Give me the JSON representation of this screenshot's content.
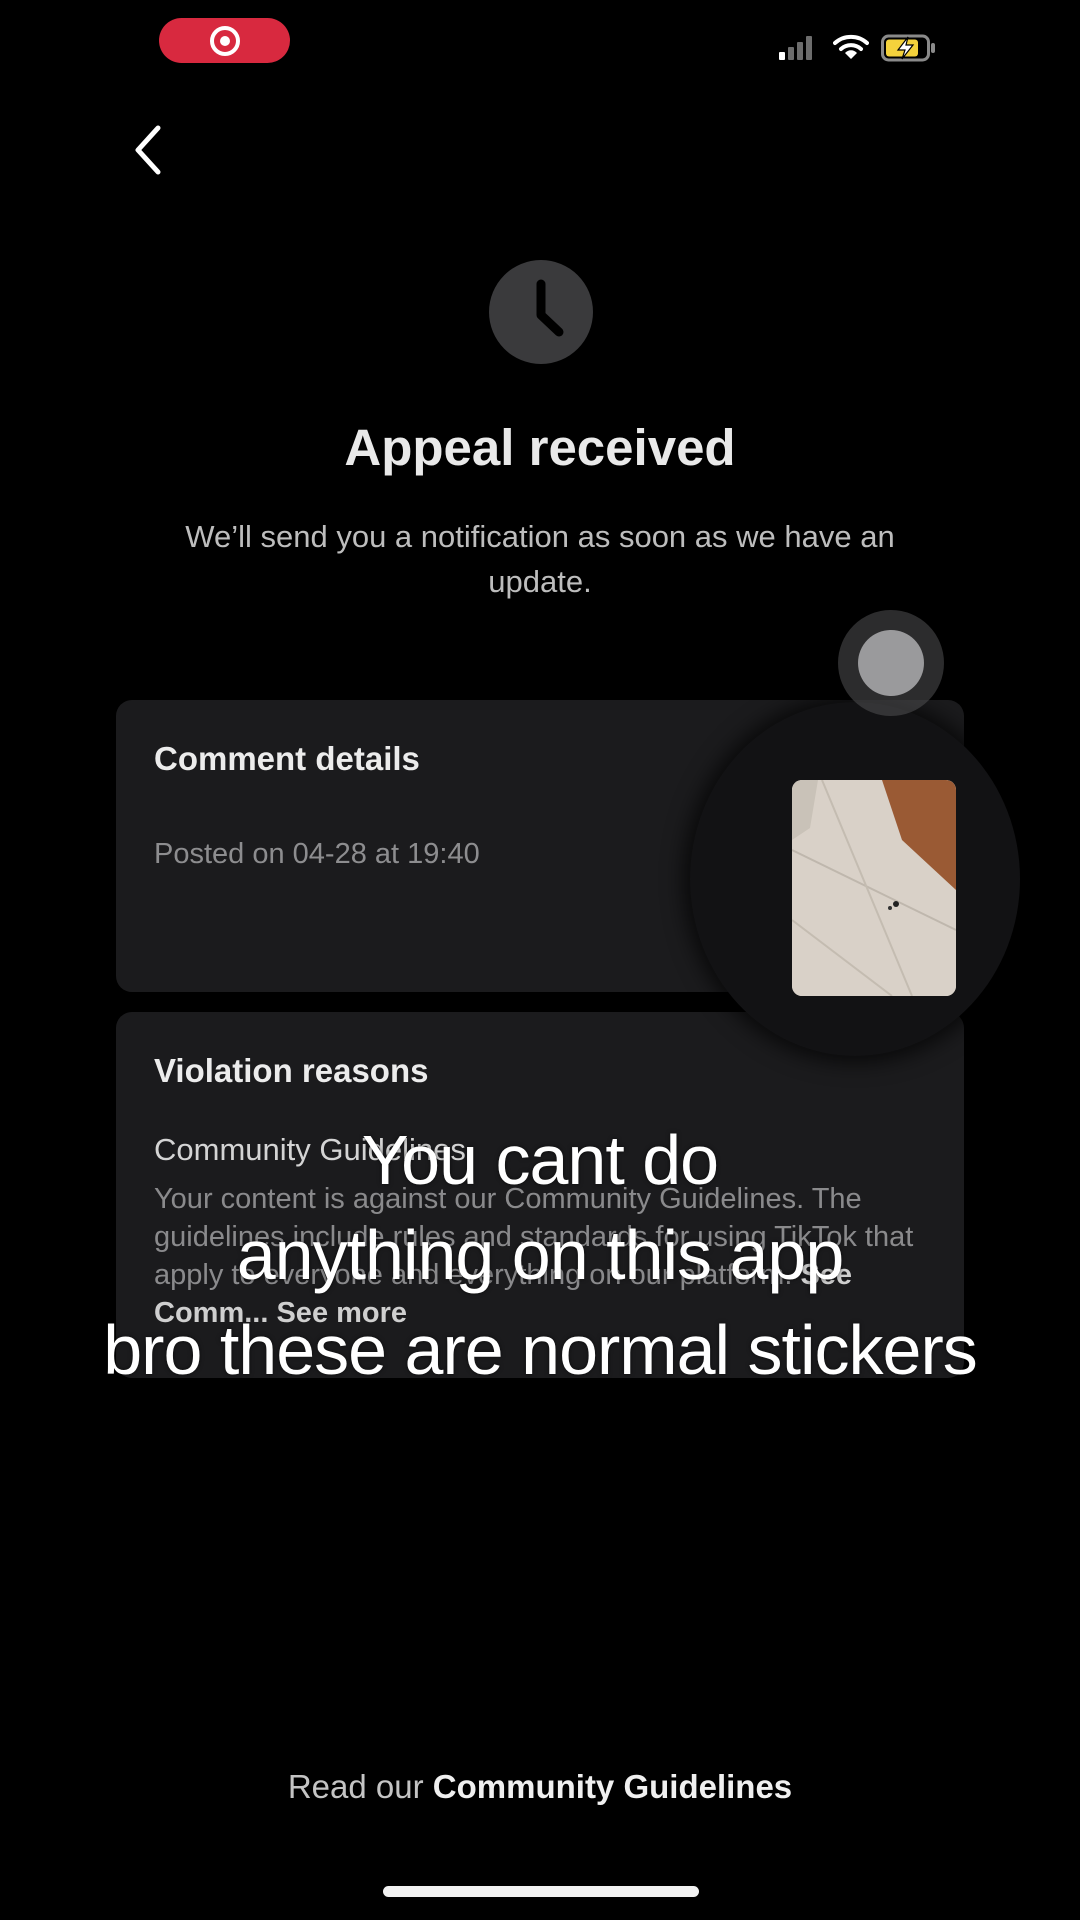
{
  "status_bar": {
    "recording_icon": "screen-recording-icon",
    "signal_icon": "cellular-signal-icon",
    "wifi_icon": "wifi-icon",
    "battery_icon": "battery-charging-icon",
    "battery_color": "#f4d23c"
  },
  "nav": {
    "back_icon": "chevron-left-icon"
  },
  "header": {
    "status_icon": "clock-icon",
    "title": "Appeal received",
    "subtitle": "We’ll send you a notification as soon as we have an update."
  },
  "comment_card": {
    "title": "Comment details",
    "posted": "Posted on 04-28 at 19:40",
    "thumbnail": "comment-sticker-thumbnail"
  },
  "violation_card": {
    "title": "Violation reasons",
    "guideline_title": "Community Guidelines",
    "body": "Your content is against our Community Guidelines. The guidelines include rules and standards for using TikTok that apply to everyone and everything on our platform.",
    "see_link": "See Comm...",
    "see_more": "See more"
  },
  "overlay_caption": {
    "line1": "You cant do",
    "line2": "anything on this app",
    "line3": "bro these are normal stickers"
  },
  "footer": {
    "prefix": "Read our",
    "link": "Community Guidelines"
  },
  "colors": {
    "background": "#000000",
    "card": "#1b1b1d",
    "record_pill": "#d8293f"
  }
}
